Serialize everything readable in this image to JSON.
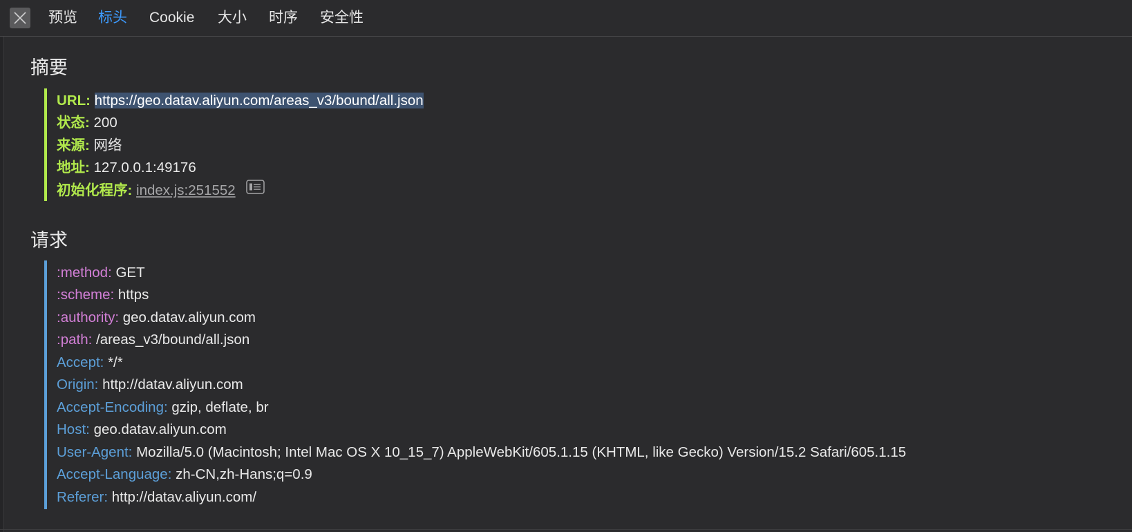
{
  "tabs": [
    {
      "label": "预览",
      "active": false
    },
    {
      "label": "标头",
      "active": true
    },
    {
      "label": "Cookie",
      "active": false
    },
    {
      "label": "大小",
      "active": false
    },
    {
      "label": "时序",
      "active": false
    },
    {
      "label": "安全性",
      "active": false
    }
  ],
  "summary": {
    "title": "摘要",
    "rows": [
      {
        "key": "URL:",
        "value": "https://geo.datav.aliyun.com/areas_v3/bound/all.json"
      },
      {
        "key": "状态:",
        "value": "200"
      },
      {
        "key": "来源:",
        "value": "网络"
      },
      {
        "key": "地址:",
        "value": "127.0.0.1:49176"
      },
      {
        "key": "初始化程序:",
        "value": "index.js:251552"
      }
    ]
  },
  "request": {
    "title": "请求",
    "rows": [
      {
        "key": ":method:",
        "value": "GET"
      },
      {
        "key": ":scheme:",
        "value": "https"
      },
      {
        "key": ":authority:",
        "value": "geo.datav.aliyun.com"
      },
      {
        "key": ":path:",
        "value": "/areas_v3/bound/all.json"
      },
      {
        "key": "Accept:",
        "value": "*/*"
      },
      {
        "key": "Origin:",
        "value": "http://datav.aliyun.com"
      },
      {
        "key": "Accept-Encoding:",
        "value": "gzip, deflate, br"
      },
      {
        "key": "Host:",
        "value": "geo.datav.aliyun.com"
      },
      {
        "key": "User-Agent:",
        "value": "Mozilla/5.0 (Macintosh; Intel Mac OS X 10_15_7) AppleWebKit/605.1.15 (KHTML, like Gecko) Version/15.2 Safari/605.1.15"
      },
      {
        "key": "Accept-Language:",
        "value": "zh-CN,zh-Hans;q=0.9"
      },
      {
        "key": "Referer:",
        "value": "http://datav.aliyun.com/"
      }
    ]
  },
  "colors": {
    "summary_key": "#b1e94c",
    "pseudo_header_key": "#d27fd6",
    "header_key": "#5c9fd8",
    "active_tab": "#3d9bff",
    "summary_bar": "#b1e94c",
    "request_bar": "#5c9fd8",
    "selection": "#3e5370"
  },
  "icons": {
    "close": "close-icon",
    "reveal_source": "reveal-source-icon"
  }
}
